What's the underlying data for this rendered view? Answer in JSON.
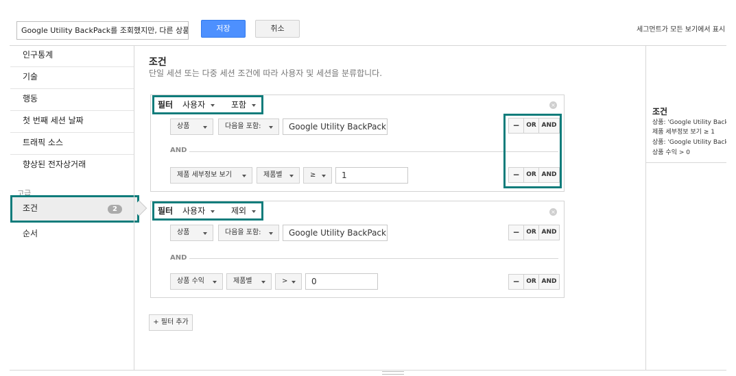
{
  "topbar": {
    "segment_name": "Google Utility BackPack를 조회했지만, 다른 상품을",
    "save_label": "저장",
    "cancel_label": "취소",
    "note": "세그먼트가 모든 보기에서 표시"
  },
  "sidebar": {
    "items": [
      "인구통계",
      "기술",
      "행동",
      "첫 번째 세션 날짜",
      "트래픽 소스",
      "향상된 전자상거래"
    ],
    "group_label": "고급",
    "active_label": "조건",
    "active_badge": "2",
    "order_label": "순서"
  },
  "main": {
    "title": "조건",
    "description": "단일 세션 또는 다중 세션 조건에 따라 사용자 및 세션을 분류합니다."
  },
  "filters": [
    {
      "label": "필터",
      "scope": "사용자",
      "mode": "포함",
      "rows": [
        {
          "dimension": "상품",
          "operator": "다음을 포함:",
          "value": "Google Utility BackPack"
        },
        {
          "dimension": "제품 세부정보 보기",
          "metric_scope": "제품별",
          "comparator": "≥",
          "value": "1"
        }
      ],
      "and_label": "AND"
    },
    {
      "label": "필터",
      "scope": "사용자",
      "mode": "제외",
      "rows": [
        {
          "dimension": "상품",
          "operator": "다음을 포함:",
          "value": "Google Utility BackPack"
        },
        {
          "dimension": "상품 수익",
          "metric_scope": "제품별",
          "comparator": ">",
          "value": "0"
        }
      ],
      "and_label": "AND"
    }
  ],
  "logic": {
    "minus": "−",
    "or": "OR",
    "and": "AND"
  },
  "add_filter_label": "+ 필터 추가",
  "summary": {
    "title": "조건",
    "lines": [
      "상품: 'Google Utility BackPack'",
      "제품 세부정보 보기 ≥ 1",
      "상품: 'Google Utility BackPack'",
      "상품 수익 > 0"
    ]
  },
  "colors": {
    "highlight": "#0e7c7b",
    "primary": "#4d90fe"
  }
}
